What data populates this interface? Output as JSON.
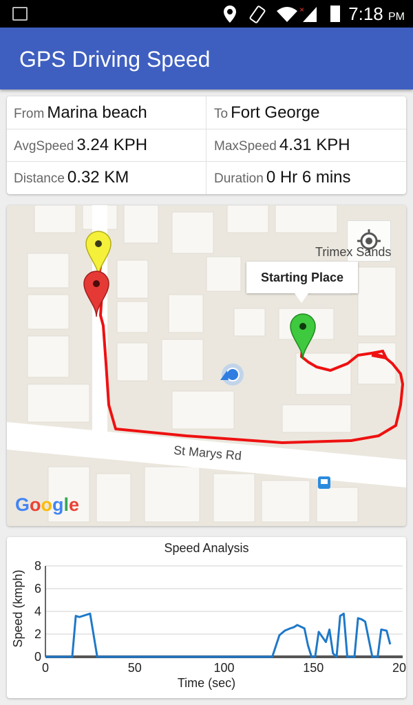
{
  "status_bar": {
    "time": "7:18",
    "ampm": "PM"
  },
  "app_bar": {
    "title": "GPS Driving Speed"
  },
  "trip": {
    "from_label": "From",
    "from_value": "Marina beach",
    "to_label": "To",
    "to_value": "Fort George",
    "avg_label": "AvgSpeed",
    "avg_value": "3.24 KPH",
    "max_label": "MaxSpeed",
    "max_value": "4.31 KPH",
    "dist_label": "Distance",
    "dist_value": "0.32 KM",
    "dur_label": "Duration",
    "dur_value": "0 Hr 6 mins"
  },
  "map": {
    "info_window": "Starting Place",
    "street_label": "St Marys Rd",
    "poi_label": "Trimex Sands",
    "attribution": "Google",
    "route_color": "#ee1111",
    "start_marker_color": "#3ec93e",
    "end_marker_color": "#e53935",
    "other_marker_color": "#f5f03a"
  },
  "chart_data": {
    "type": "line",
    "title": "Speed Analysis",
    "xlabel": "Time (sec)",
    "ylabel": "Speed (kmph)",
    "xlim": [
      0,
      200
    ],
    "ylim": [
      0,
      8
    ],
    "xticks": [
      "0",
      "50",
      "100",
      "150",
      "200"
    ],
    "yticks": [
      "0",
      "2",
      "4",
      "6",
      "8"
    ],
    "grid": true,
    "series": [
      {
        "color": "#1f78c8",
        "x": [
          0,
          15,
          17,
          19,
          25,
          29,
          32,
          35,
          40,
          127,
          131,
          134,
          137,
          139,
          141,
          145,
          147,
          149,
          151,
          153,
          157,
          159,
          161,
          163,
          165,
          167,
          169,
          171,
          173,
          175,
          177,
          179,
          183,
          186,
          188,
          191,
          193
        ],
        "y": [
          0,
          0,
          3.6,
          3.5,
          3.8,
          0,
          0,
          0,
          0,
          0,
          1.9,
          2.3,
          2.5,
          2.6,
          2.8,
          2.5,
          1.0,
          0,
          0,
          2.2,
          1.3,
          2.4,
          0.3,
          0,
          3.6,
          3.8,
          0,
          0,
          0,
          3.4,
          3.3,
          3.1,
          0,
          0,
          2.4,
          2.3,
          1.1
        ]
      }
    ]
  }
}
